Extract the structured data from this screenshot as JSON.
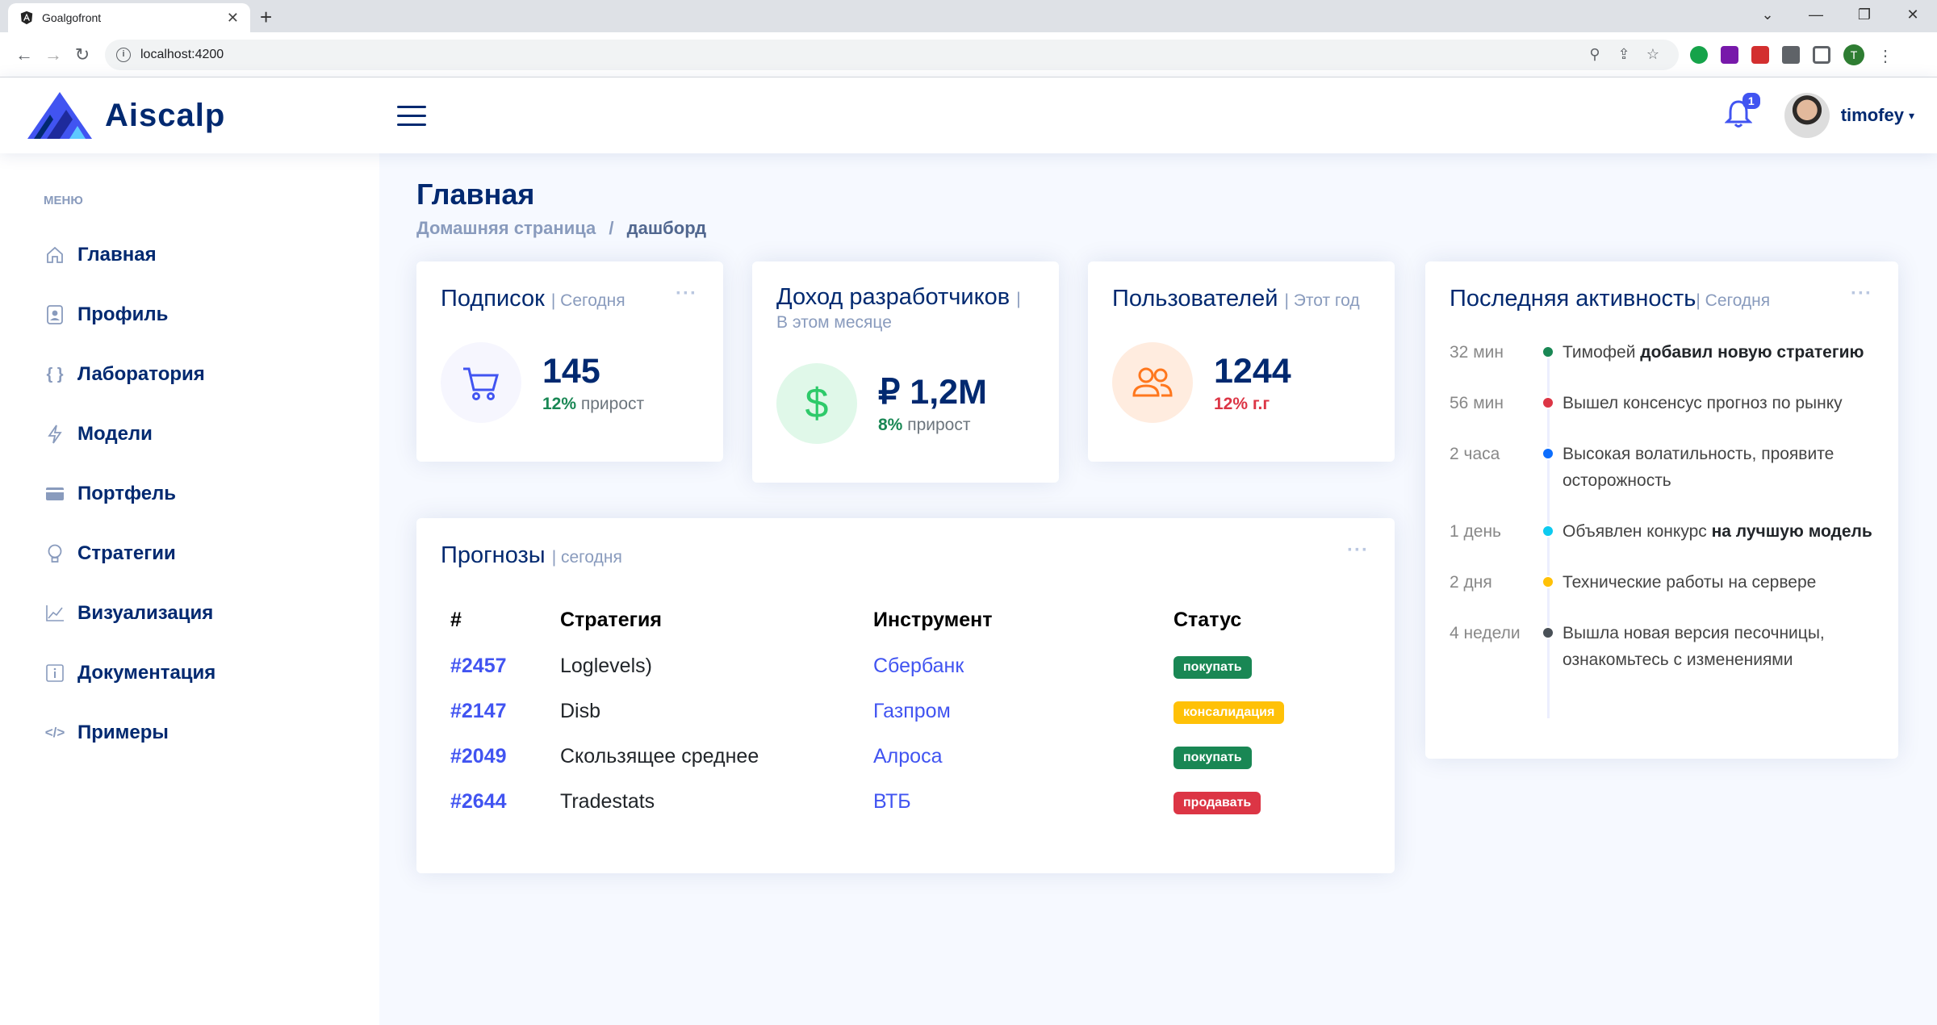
{
  "browser": {
    "tab_title": "Goalgofront",
    "url": "localhost:4200",
    "profile_initial": "T"
  },
  "header": {
    "logo_text": "Aiscalp",
    "notification_count": "1",
    "username": "timofey"
  },
  "sidebar": {
    "heading": "МЕНЮ",
    "items": [
      {
        "label": "Главная",
        "icon": "house-icon"
      },
      {
        "label": "Профиль",
        "icon": "person-badge-icon"
      },
      {
        "label": "Лаборатория",
        "icon": "braces-icon"
      },
      {
        "label": "Модели",
        "icon": "lightning-icon"
      },
      {
        "label": "Портфель",
        "icon": "wallet-icon"
      },
      {
        "label": "Стратегии",
        "icon": "lightbulb-icon"
      },
      {
        "label": "Визуализация",
        "icon": "graph-up-icon"
      },
      {
        "label": "Документация",
        "icon": "info-square-icon"
      },
      {
        "label": "Примеры",
        "icon": "code-slash-icon"
      }
    ]
  },
  "page": {
    "title": "Главная",
    "breadcrumb_home": "Домашняя страница",
    "breadcrumb_sep": "/",
    "breadcrumb_current": "дашборд"
  },
  "cards": {
    "subscriptions": {
      "title": "Подписок",
      "sub": "| Сегодня",
      "value": "145",
      "pct": "12%",
      "pct_label": "прирост",
      "pct_color": "#198754"
    },
    "revenue": {
      "title": "Доход разработчиков",
      "sub": "| В этом месяце",
      "value": "₽ 1,2M",
      "pct": "8%",
      "pct_label": "прирост",
      "pct_color": "#198754"
    },
    "users": {
      "title": "Пользователей",
      "sub": "| Этот год",
      "value": "1244",
      "pct": "12% г.г",
      "pct_label": "",
      "pct_color": "#dc3545"
    }
  },
  "forecasts": {
    "title": "Прогнозы",
    "sub": "| сегодня",
    "columns": [
      "#",
      "Стратегия",
      "Инструмент",
      "Статус"
    ],
    "rows": [
      {
        "id": "#2457",
        "strategy": "Loglevels)",
        "instrument": "Сбербанк",
        "status": "покупать",
        "color": "#198754"
      },
      {
        "id": "#2147",
        "strategy": "Disb",
        "instrument": "Газпром",
        "status": "консалидация",
        "color": "#ffc107"
      },
      {
        "id": "#2049",
        "strategy": "Скользящее среднее",
        "instrument": "Алроса",
        "status": "покупать",
        "color": "#198754"
      },
      {
        "id": "#2644",
        "strategy": "Tradestats",
        "instrument": "ВТБ",
        "status": "продавать",
        "color": "#dc3545"
      }
    ]
  },
  "activity": {
    "title": "Последняя активность",
    "sub": "| Сегодня",
    "items": [
      {
        "time": "32 мин",
        "color": "#198754",
        "text": "Тимофей ",
        "bold": "добавил новую стратегию"
      },
      {
        "time": "56 мин",
        "color": "#dc3545",
        "text": "Вышел консенсус прогноз по рынку",
        "bold": ""
      },
      {
        "time": "2 часа",
        "color": "#0d6efd",
        "text": "Высокая волатильность, проявите осторожность",
        "bold": ""
      },
      {
        "time": "1 день",
        "color": "#0dcaf0",
        "text": "Объявлен конкурс ",
        "bold": "на лучшую модель"
      },
      {
        "time": "2 дня",
        "color": "#ffc107",
        "text": "Технические работы на сервере",
        "bold": ""
      },
      {
        "time": "4 недели",
        "color": "#495057",
        "text": "Вышла новая версия песочницы, ознакомьтесь с изменениями",
        "bold": ""
      }
    ]
  }
}
